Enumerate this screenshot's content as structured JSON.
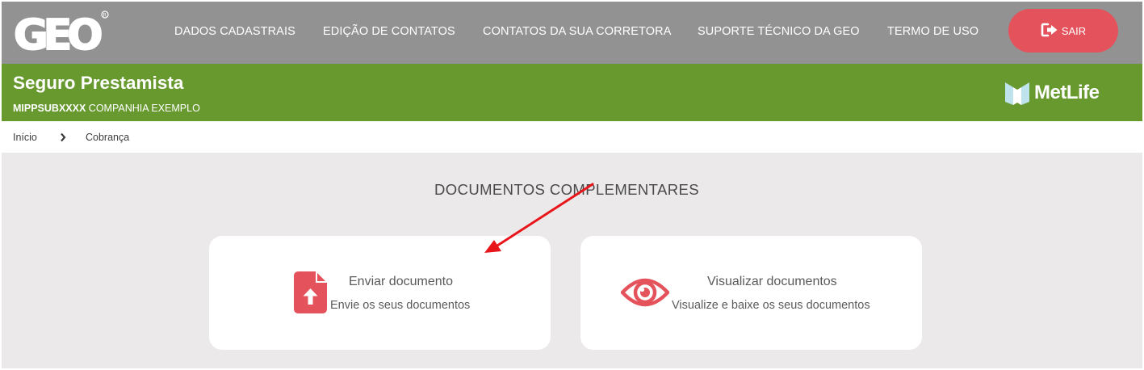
{
  "header": {
    "logo_text": "GEO",
    "nav": [
      "DADOS CADASTRAIS",
      "EDIÇÃO DE CONTATOS",
      "CONTATOS DA SUA CORRETORA",
      "SUPORTE TÉCNICO DA GEO",
      "TERMO DE USO"
    ],
    "logout_label": "SAIR",
    "logout_icon": "sign-out-icon"
  },
  "product": {
    "title": "Seguro Prestamista",
    "code": "MIPPSUBXXXX",
    "company": "COMPANHIA EXEMPLO",
    "brand": "MetLife"
  },
  "breadcrumb": {
    "items": [
      "Início",
      "Cobrança"
    ],
    "separator_icon": "chevron-right-icon"
  },
  "main": {
    "section_title": "DOCUMENTOS COMPLEMENTARES",
    "cards": [
      {
        "title": "Enviar documento",
        "subtitle": "Envie os seus documentos",
        "icon": "file-upload-icon"
      },
      {
        "title": "Visualizar documentos",
        "subtitle": "Visualize e baixe os seus documentos",
        "icon": "eye-icon"
      }
    ]
  },
  "colors": {
    "topbar": "#929292",
    "greenbar": "#67992f",
    "accent": "#e4525b",
    "page_bg": "#ebe9ea",
    "annotation_arrow": "#e8161b"
  }
}
